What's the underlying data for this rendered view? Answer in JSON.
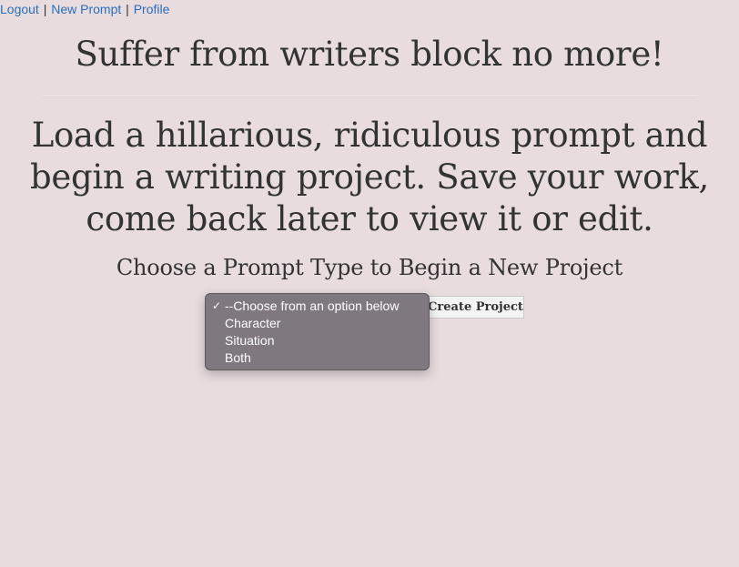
{
  "nav": {
    "logout": "Logout",
    "new_prompt": "New Prompt",
    "profile": "Profile",
    "separator": "|"
  },
  "headline": "Suffer from writers block no more!",
  "intro": "Load a hillarious, ridiculous prompt and begin a writing project. Save your work, come back later to view it or edit.",
  "subhead": "Choose a Prompt Type to Begin a New Project",
  "select": {
    "options": [
      "--Choose from an option below",
      "Character",
      "Situation",
      "Both"
    ],
    "selected_index": 0,
    "check_glyph": "✓"
  },
  "create_button": "Create Project",
  "colors": {
    "background": "#e8dcdf",
    "link": "#2a6fb8",
    "text": "#333333",
    "dropdown_bg": "#767076"
  }
}
